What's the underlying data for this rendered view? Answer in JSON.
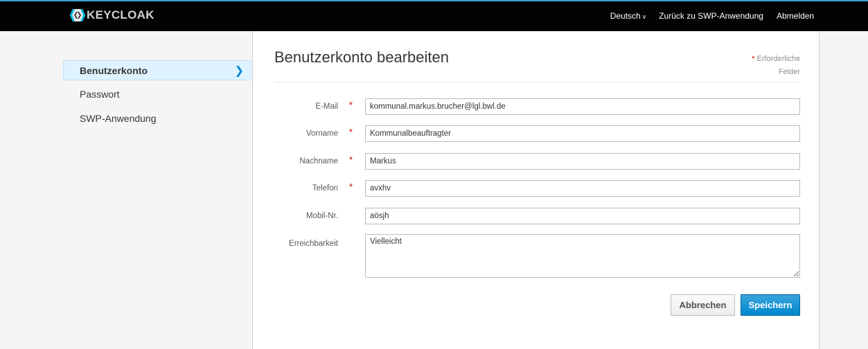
{
  "header": {
    "logo_text": "KEYCLOAK",
    "language": "Deutsch",
    "back_link": "Zurück zu SWP-Anwendung",
    "logout": "Abmelden"
  },
  "sidebar": {
    "items": [
      {
        "label": "Benutzerkonto",
        "active": true
      },
      {
        "label": "Passwort",
        "active": false
      },
      {
        "label": "SWP-Anwendung",
        "active": false
      }
    ]
  },
  "main": {
    "title": "Benutzerkonto bearbeiten",
    "required_note_star": "*",
    "required_note_line1": "Erforderliche",
    "required_note_line2": "Felder",
    "fields": [
      {
        "label": "E-Mail",
        "required": true,
        "value": "kommunal.markus.brucher@lgl.bwl.de"
      },
      {
        "label": "Vorname",
        "required": true,
        "value": "Kommunalbeauftragter"
      },
      {
        "label": "Nachname",
        "required": true,
        "value": "Markus"
      },
      {
        "label": "Telefon",
        "required": true,
        "value": "avxhv"
      },
      {
        "label": "Mobil-Nr.",
        "required": false,
        "value": "aösjh"
      },
      {
        "label": "Erreichbarkeit",
        "required": false,
        "value": "Vielleicht"
      }
    ],
    "cancel_label": "Abbrechen",
    "save_label": "Speichern"
  },
  "colors": {
    "topbar": "#030303",
    "accent": "#0088ce",
    "required": "#cc0000"
  }
}
